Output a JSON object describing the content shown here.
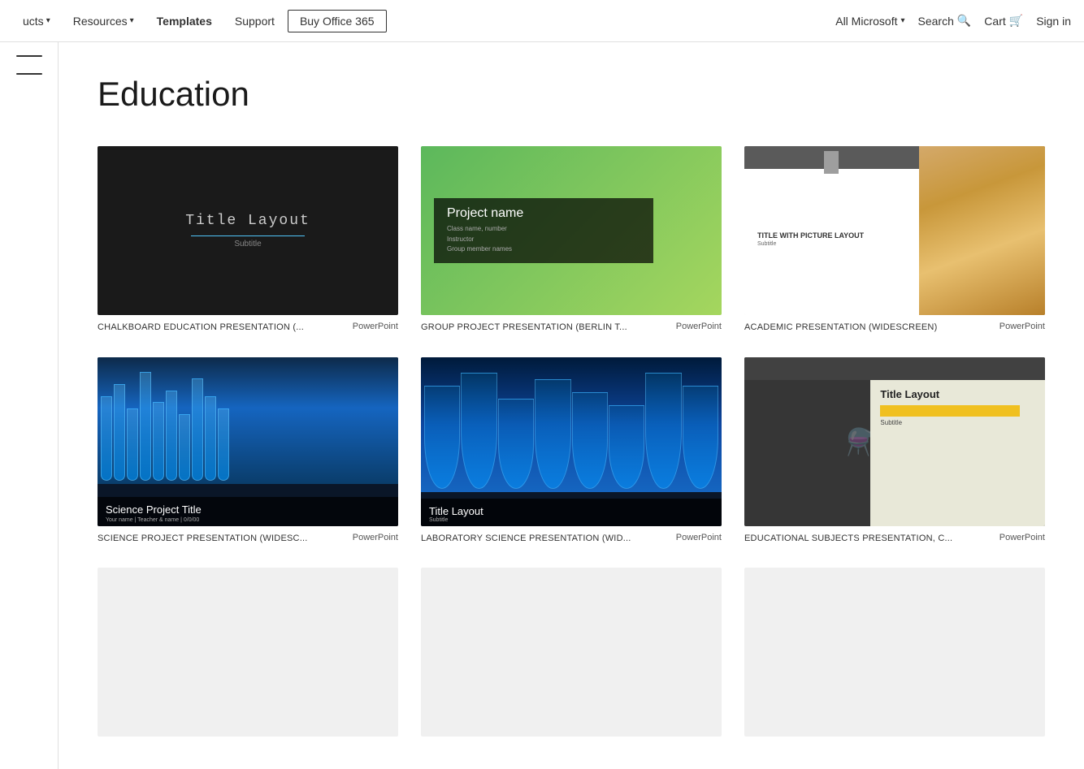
{
  "nav": {
    "items_left": [
      {
        "id": "products",
        "label": "ucts",
        "arrow": true
      },
      {
        "id": "resources",
        "label": "Resources",
        "arrow": true
      },
      {
        "id": "templates",
        "label": "Templates",
        "active": true
      },
      {
        "id": "support",
        "label": "Support"
      }
    ],
    "buy_btn": "Buy Office 365",
    "items_right": [
      {
        "id": "all-microsoft",
        "label": "All Microsoft",
        "arrow": true
      },
      {
        "id": "search",
        "label": "Search"
      },
      {
        "id": "cart",
        "label": "Cart"
      },
      {
        "id": "signin",
        "label": "Sign in"
      }
    ]
  },
  "page": {
    "title": "Education"
  },
  "templates": [
    {
      "id": "chalkboard",
      "name": "CHALKBOARD EDUCATION PRESENTATION (...",
      "type": "PowerPoint",
      "thumb_type": "chalkboard",
      "preview_title": "Title Layout",
      "preview_subtitle": "Subtitle"
    },
    {
      "id": "group-project",
      "name": "GROUP PROJECT PRESENTATION (BERLIN T...",
      "type": "PowerPoint",
      "thumb_type": "group",
      "preview_title": "Project name",
      "preview_detail1": "Class name, number",
      "preview_detail2": "Instructor",
      "preview_detail3": "Group member names"
    },
    {
      "id": "academic",
      "name": "ACADEMIC PRESENTATION (WIDESCREEN)",
      "type": "PowerPoint",
      "thumb_type": "academic",
      "preview_title": "TITLE WITH PICTURE LAYOUT",
      "preview_subtitle": "Subtitle"
    },
    {
      "id": "science-project",
      "name": "SCIENCE PROJECT PRESENTATION (WIDESC...",
      "type": "PowerPoint",
      "thumb_type": "science",
      "preview_title": "Science Project Title",
      "preview_name": "Your name | Teacher & name | 0/0/00"
    },
    {
      "id": "lab-science",
      "name": "LABORATORY SCIENCE PRESENTATION (WID...",
      "type": "PowerPoint",
      "thumb_type": "lab",
      "preview_title": "Title Layout",
      "preview_subtitle": "Subtitle"
    },
    {
      "id": "edu-subjects",
      "name": "EDUCATIONAL SUBJECTS PRESENTATION, C...",
      "type": "PowerPoint",
      "thumb_type": "edu",
      "preview_title": "Title Layout",
      "preview_subtitle": "Subtitle"
    }
  ],
  "bottom_row": [
    {
      "id": "placeholder1",
      "name": "",
      "type": "",
      "thumb_type": "placeholder"
    },
    {
      "id": "placeholder2",
      "name": "",
      "type": "",
      "thumb_type": "placeholder"
    },
    {
      "id": "placeholder3",
      "name": "",
      "type": "",
      "thumb_type": "placeholder"
    }
  ]
}
